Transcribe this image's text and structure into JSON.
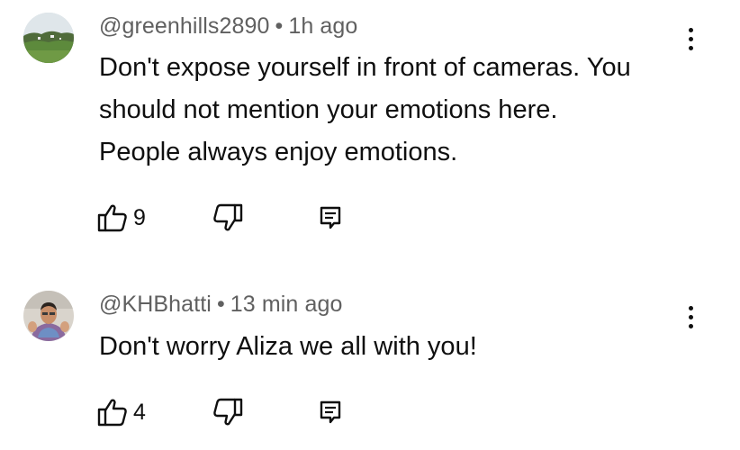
{
  "comments": [
    {
      "author": "@greenhills2890",
      "separator": "•",
      "time": "1h ago",
      "lines": [
        "Don't expose yourself in front of cameras. You",
        "should not mention your emotions here.",
        "People always enjoy emotions."
      ],
      "likes": "9",
      "avatar_icon": "landscape-avatar-icon"
    },
    {
      "author": "@KHBhatti",
      "separator": "•",
      "time": "13 min ago",
      "lines": [
        "Don't worry Aliza we all with you!"
      ],
      "likes": "4",
      "avatar_icon": "person-avatar-icon"
    }
  ],
  "icons": {
    "like": "thumbs-up-icon",
    "dislike": "thumbs-down-icon",
    "reply": "reply-icon",
    "menu": "more-vertical-icon"
  },
  "colors": {
    "text": "#0f0f0f",
    "meta": "#606060",
    "background": "#ffffff"
  }
}
